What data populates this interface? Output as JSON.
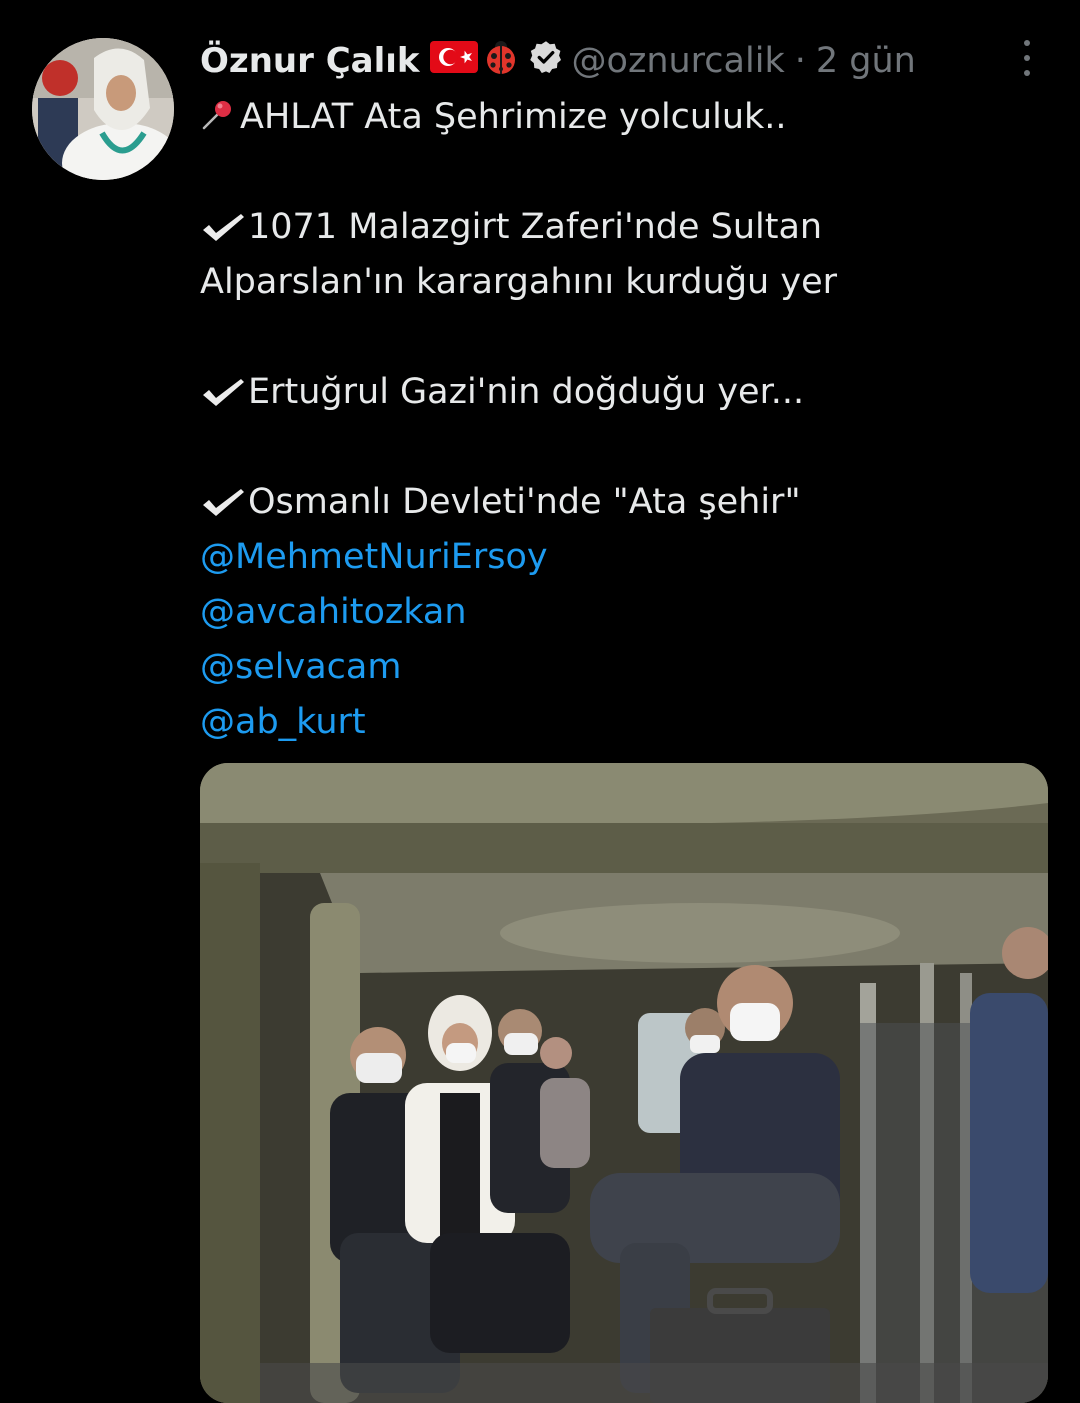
{
  "tweet": {
    "author_name": "Öznur Çalık",
    "handle": "@oznurcalik",
    "separator": "·",
    "time": "2 gün",
    "lines": {
      "l1": "AHLAT Ata Şehrimize yolculuk..",
      "l2": "1071 Malazgirt Zaferi'nde Sultan",
      "l3": "Alparslan'ın karargahını kurduğu yer",
      "l4": "Ertuğrul Gazi'nin doğduğu yer...",
      "l5": "Osmanlı Devleti'nde \"Ata şehir\""
    },
    "mentions": [
      "@MehmetNuriErsoy",
      "@avcahitozkan",
      "@selvacam",
      "@ab_kurt"
    ],
    "icons": {
      "pin": "round-pushpin-icon",
      "check": "heavy-check-mark-icon",
      "flag": "turkey-flag-icon",
      "ladybug": "ladybug-icon",
      "verified": "verified-badge-icon",
      "more": "more-vertical-icon"
    }
  },
  "colors": {
    "background": "#000000",
    "text": "#e7e9ea",
    "secondary": "#71767b",
    "link": "#1d9bf0"
  }
}
